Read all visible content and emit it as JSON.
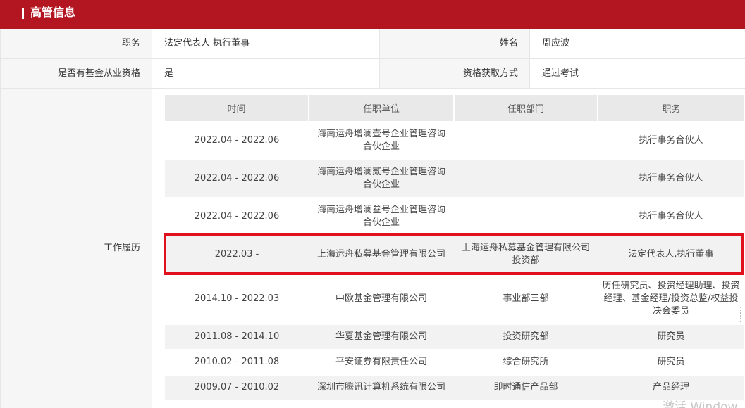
{
  "header": {
    "title": "高管信息"
  },
  "info": {
    "position_label": "职务",
    "position_value": "法定代表人 执行董事",
    "name_label": "姓名",
    "name_value": "周应波",
    "qualified_label": "是否有基金从业资格",
    "qualified_value": "是",
    "method_label": "资格获取方式",
    "method_value": "通过考试",
    "history_label": "工作履历"
  },
  "history": {
    "columns": [
      "时间",
      "任职单位",
      "任职部门",
      "职务"
    ],
    "rows": [
      {
        "time": "2022.04 - 2022.06",
        "org": "海南运舟增澜壹号企业管理咨询合伙企业",
        "dept": "",
        "title": "执行事务合伙人"
      },
      {
        "time": "2022.04 - 2022.06",
        "org": "海南运舟增澜贰号企业管理咨询合伙企业",
        "dept": "",
        "title": "执行事务合伙人"
      },
      {
        "time": "2022.04 - 2022.06",
        "org": "海南运舟增澜叁号企业管理咨询合伙企业",
        "dept": "",
        "title": "执行事务合伙人"
      },
      {
        "time": "2022.03 -",
        "org": "上海运舟私募基金管理有限公司",
        "dept": "上海运舟私募基金管理有限公司投资部",
        "title": "法定代表人,执行董事"
      },
      {
        "time": "2014.10 - 2022.03",
        "org": "中欧基金管理有限公司",
        "dept": "事业部三部",
        "title": "历任研究员、投资经理助理、投资经理、基金经理/投资总监/权益投决会委员"
      },
      {
        "time": "2011.08 - 2014.10",
        "org": "华夏基金管理有限公司",
        "dept": "投资研究部",
        "title": "研究员"
      },
      {
        "time": "2010.02 - 2011.08",
        "org": "平安证券有限责任公司",
        "dept": "综合研究所",
        "title": "研究员"
      },
      {
        "time": "2009.07 - 2010.02",
        "org": "深圳市腾讯计算机系统有限公司",
        "dept": "即时通信产品部",
        "title": "产品经理"
      }
    ]
  },
  "watermark": "激活 Window",
  "colors": {
    "accent": "#b31620",
    "highlight": "#e0101c"
  }
}
